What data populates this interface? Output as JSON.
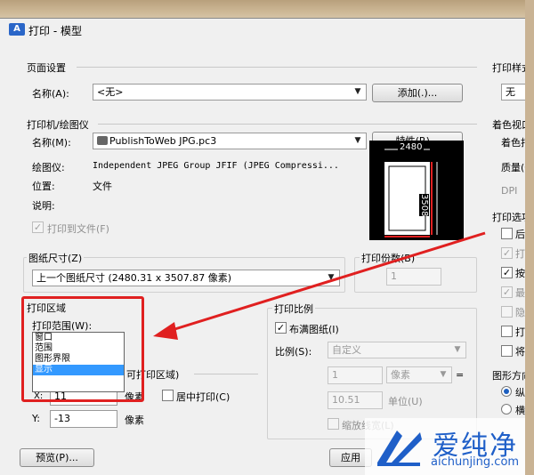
{
  "window": {
    "app_icon": "A",
    "title": "打印 - 模型"
  },
  "page_setup": {
    "title": "页面设置",
    "name_label": "名称(A):",
    "name_value": "<无>",
    "add_button": "添加(.)..."
  },
  "printer": {
    "title": "打印机/绘图仪",
    "name_label": "名称(M):",
    "name_value": "PublishToWeb JPG.pc3",
    "properties_button": "特性(R)...",
    "plotter_label": "绘图仪:",
    "plotter_value": "Independent JPEG Group JFIF (JPEG Compressi...",
    "location_label": "位置:",
    "location_value": "文件",
    "description_label": "说明:",
    "print_to_file_label": "打印到文件(F)",
    "preview_width": "2480",
    "preview_height": "3508"
  },
  "paper_size": {
    "title": "图纸尺寸(Z)",
    "value": "上一个图纸尺寸  (2480.31 x 3507.87 像素)"
  },
  "copies": {
    "title": "打印份数(B)",
    "value": "1"
  },
  "print_area": {
    "title": "打印区域",
    "range_label": "打印范围(W):",
    "range_value": "显示",
    "options": [
      "窗口",
      "范围",
      "图形界限",
      "显示"
    ],
    "selected_option": "显示"
  },
  "print_offset": {
    "title_fragment": "可打印区域)",
    "x_label": "X:",
    "x_value": "11",
    "x_unit": "像素",
    "y_label": "Y:",
    "y_value": "-13",
    "y_unit": "像素",
    "center_label": "居中打印(C)"
  },
  "print_scale": {
    "title": "打印比例",
    "fit_label": "布满图纸(I)",
    "scale_label": "比例(S):",
    "scale_value": "自定义",
    "value1": "1",
    "unit_value": "像素",
    "equals": "=",
    "value2": "10.51",
    "unit_label": "单位(U)",
    "scale_lineweights_label": "缩放线宽(L)"
  },
  "right_panel": {
    "style_title": "打印样式",
    "style_value": "无",
    "shaded_title": "着色视口",
    "shade_label": "着色打",
    "quality_label": "质量(Q",
    "dpi_label": "DPI",
    "options_title": "打印选项",
    "options": [
      {
        "label": "后台",
        "checked": false,
        "disabled": false
      },
      {
        "label": "打印",
        "checked": true,
        "disabled": true
      },
      {
        "label": "按样",
        "checked": true,
        "disabled": false
      },
      {
        "label": "最后",
        "checked": true,
        "disabled": true
      },
      {
        "label": "隐藏",
        "checked": false,
        "disabled": true
      },
      {
        "label": "打开",
        "checked": false,
        "disabled": false
      },
      {
        "label": "将修",
        "checked": false,
        "disabled": false
      }
    ],
    "orientation_title": "图形方向",
    "portrait_label": "纵向",
    "landscape_label": "横向"
  },
  "footer": {
    "preview_button": "预览(P)...",
    "apply_button": "应用"
  },
  "watermark": {
    "text": "爱纯净",
    "url": "aichunjing.com"
  },
  "colors": {
    "highlight": "#e02020",
    "selection": "#3399ff",
    "watermark": "#1f5fc8"
  }
}
